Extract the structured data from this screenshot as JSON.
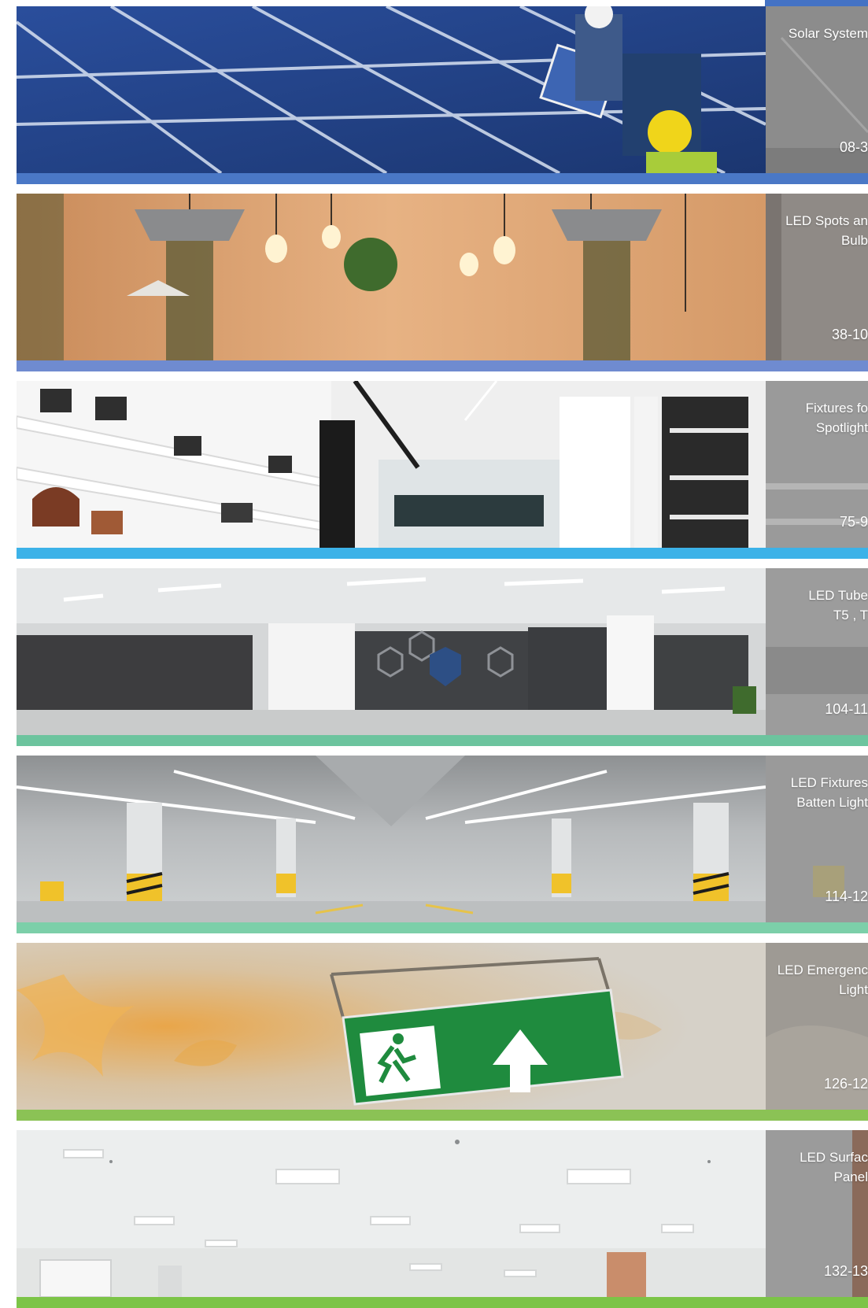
{
  "colors": {
    "top_strip": "#4472c4",
    "side_panel": "#8c8c8c"
  },
  "sections": [
    {
      "title_lines": [
        "Solar System"
      ],
      "pages": "08-3",
      "stripe_color": "#4a78c6"
    },
    {
      "title_lines": [
        "LED Spots an",
        "Bulb"
      ],
      "pages": "38-10",
      "stripe_color": "#6f8bd0"
    },
    {
      "title_lines": [
        "Fixtures fo",
        "Spotlight"
      ],
      "pages": "75-9",
      "stripe_color": "#3cb2e8"
    },
    {
      "title_lines": [
        "LED Tube",
        "T5 , T"
      ],
      "pages": "104-11",
      "stripe_color": "#6cc49e"
    },
    {
      "title_lines": [
        "LED Fixtures",
        "Batten Light"
      ],
      "pages": "114-12",
      "stripe_color": "#7ccfa9"
    },
    {
      "title_lines": [
        "LED Emergenc",
        "Light"
      ],
      "pages": "126-12",
      "stripe_color": "#8bc255"
    },
    {
      "title_lines": [
        "LED Surfac",
        "Panel"
      ],
      "pages": "132-13",
      "stripe_color": "#7cc447"
    }
  ]
}
